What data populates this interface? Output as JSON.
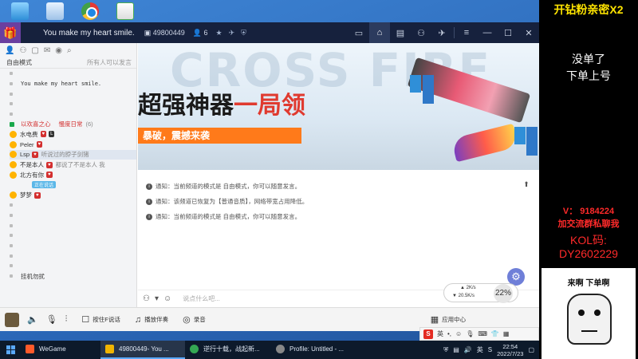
{
  "app": {
    "title": "You make my heart smile.",
    "room_id": "49800449",
    "user_count": "6"
  },
  "left": {
    "mode": "自由模式",
    "mode_right": "所有人可以发言",
    "rows": [
      {
        "type": "dot",
        "text": ""
      },
      {
        "type": "dot",
        "text": "You make my heart smile.",
        "mono": true
      },
      {
        "type": "dot",
        "text": ""
      },
      {
        "type": "dot",
        "text": ""
      },
      {
        "type": "dot",
        "text": ""
      },
      {
        "type": "marker",
        "text": "以欢喜之心",
        "text2": "慢度日常",
        "count": "(6)"
      },
      {
        "type": "user",
        "text": "水电费",
        "badge2": "L"
      },
      {
        "type": "user",
        "text": "Peler"
      },
      {
        "type": "user",
        "text": "Lsp",
        "muted": "听说过的脖子剑猪",
        "hl": true
      },
      {
        "type": "user",
        "text": "不是本人",
        "muted": "都说了不是本人 我"
      },
      {
        "type": "user",
        "text": "北方有你"
      },
      {
        "type": "chip",
        "text": "正在说话"
      },
      {
        "type": "user",
        "text": "梦梦"
      },
      {
        "type": "dot",
        "text": ""
      },
      {
        "type": "dot",
        "text": ""
      },
      {
        "type": "dot",
        "text": ""
      },
      {
        "type": "dot",
        "text": ""
      },
      {
        "type": "dot",
        "text": ""
      },
      {
        "type": "dot",
        "text": ""
      },
      {
        "type": "dot",
        "text": ""
      },
      {
        "type": "dot",
        "text": "挂机勿扰"
      }
    ]
  },
  "banner": {
    "title_part1": "超强神器",
    "title_part2": "一局领",
    "subtitle": "暴破，震撼来袭"
  },
  "notices": [
    "通知：当前频道的模式是 自由模式，你可以随意发言。",
    "通知：该频道已恢复为【普通音质】，网络带宽占用降低。",
    "通知：当前频道的模式是 自由模式，你可以随意发言。"
  ],
  "input": {
    "placeholder": "说点什么吧..."
  },
  "toolbar": {
    "press_f": "按住F说话",
    "accompany": "播放伴奏",
    "record": "录音",
    "app_center": "应用中心"
  },
  "network": {
    "up": "2K/s",
    "down": "20.5K/s",
    "percent": "22%"
  },
  "overlay": {
    "title": "开钻粉亲密X2",
    "line1": "没单了",
    "line2": "下单上号",
    "v": "V： 9184224",
    "group": "加交流群私聊我",
    "kol_label": "KOL码:",
    "kol_code": "DY2602229",
    "meme_text": "来啊 下单啊"
  },
  "taskbar": {
    "tasks": [
      {
        "label": "WeGame",
        "color": "#ff5a2a"
      },
      {
        "label": "49800449-  You ...",
        "color": "#f0b400",
        "active": true
      },
      {
        "label": "逆行十载，战起新...",
        "color": "#34a853"
      },
      {
        "label": "Profile: Untitled - ...",
        "color": "#888888"
      }
    ],
    "ime_lang": "英",
    "time": "22:54",
    "date": "2022/7/23"
  }
}
